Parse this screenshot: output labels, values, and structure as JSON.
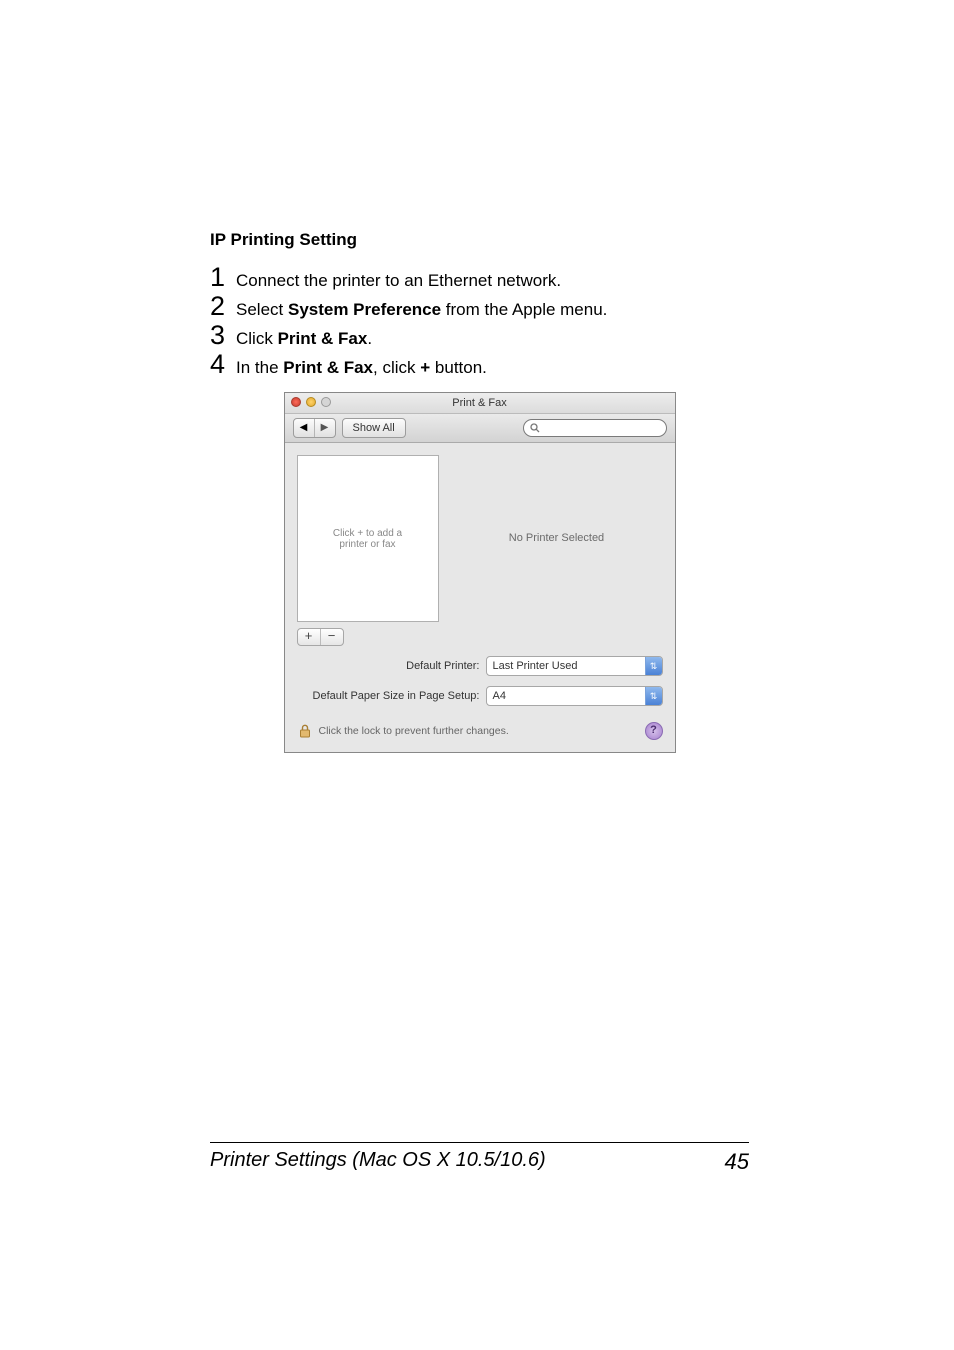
{
  "section_title": "IP Printing Setting",
  "steps": [
    {
      "num": "1",
      "pre": "Connect the printer to an Ethernet network."
    },
    {
      "num": "2",
      "pre": "Select ",
      "bold": "System Preference",
      "post": " from the Apple menu."
    },
    {
      "num": "3",
      "pre": "Click ",
      "bold": "Print & Fax",
      "post": "."
    },
    {
      "num": "4",
      "pre": "In the ",
      "bold": "Print & Fax",
      "post": ", click ",
      "bold2": "+",
      "post2": " button."
    }
  ],
  "screenshot": {
    "title": "Print & Fax",
    "nav_back": "◀",
    "nav_fwd": "▶",
    "show_all": "Show All",
    "list_hint": "Click + to add a\nprinter or fax",
    "no_printer": "No Printer Selected",
    "plus": "+",
    "minus": "−",
    "default_printer_label": "Default Printer:",
    "default_printer_value": "Last Printer Used",
    "paper_size_label": "Default Paper Size in Page Setup:",
    "paper_size_value": "A4",
    "lock_text": "Click the lock to prevent further changes.",
    "help": "?",
    "updown": "⇅"
  },
  "footer": {
    "left": "Printer Settings (Mac OS X 10.5/10.6)",
    "right": "45"
  }
}
